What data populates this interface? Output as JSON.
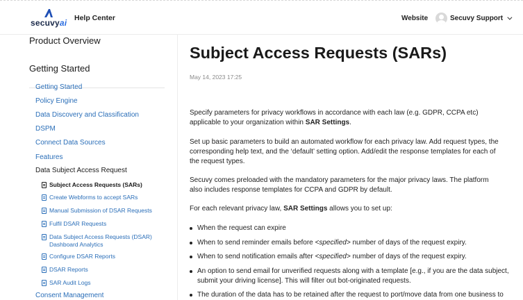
{
  "header": {
    "logo_main": "secuvy",
    "logo_suffix": "ai",
    "help_center": "Help Center",
    "website": "Website",
    "user_name": "Secuvy Support"
  },
  "sidebar": {
    "product_overview": "Product Overview",
    "getting_started": "Getting Started",
    "items": [
      "Getting Started",
      "Policy Engine",
      "Data Discovery and Classification",
      "DSPM",
      "Connect Data Sources",
      "Features",
      "Data Subject Access Request"
    ],
    "subitems": [
      "Subject Access Requests (SARs)",
      "Create Webforms to accept SARs",
      "Manual Submission of DSAR Requests",
      "Fulfil DSAR Requests",
      "Data Subject Access Requests (DSAR) Dashboard Analytics",
      "Configure DSAR Reports",
      "DSAR Reports",
      "SAR Audit Logs"
    ],
    "last_item": "Consent Management"
  },
  "article": {
    "title": "Subject Access Requests (SARs)",
    "date": "May 14, 2023 17:25",
    "p1_a": "Specify parameters for privacy workflows in accordance with each law (e.g. GDPR, CCPA etc) applicable to your organization within ",
    "p1_b": "SAR Settings",
    "p1_c": ".",
    "p2": "Set up basic parameters to build an automated workflow for each privacy law. Add request types, the corresponding help text, and the ‘default’ setting option. Add/edit the response templates for each of the request types.",
    "p3": "Secuvy comes preloaded with the mandatory parameters for the major privacy laws. The platform also includes response templates for CCPA and GDPR by default.",
    "p4_a": "For each relevant privacy law, ",
    "p4_b": "SAR Settings",
    "p4_c": " allows you to set up:",
    "b1": "When the request can expire",
    "b2_a": "When to send reminder emails before ",
    "b2_i": "<specified>",
    "b2_b": " number of days of the request expiry.",
    "b3_a": "When to send notification emails after ",
    "b3_i": "<specified>",
    "b3_b": " number of days of the request expiry.",
    "b4": "An option to send email for unverified requests along with a template [e.g., if you are the data subject, submit your driving license]. This will filter out bot-originated requests.",
    "b5": "The duration of the data has to be retained after the request to port/move data from one business to"
  }
}
